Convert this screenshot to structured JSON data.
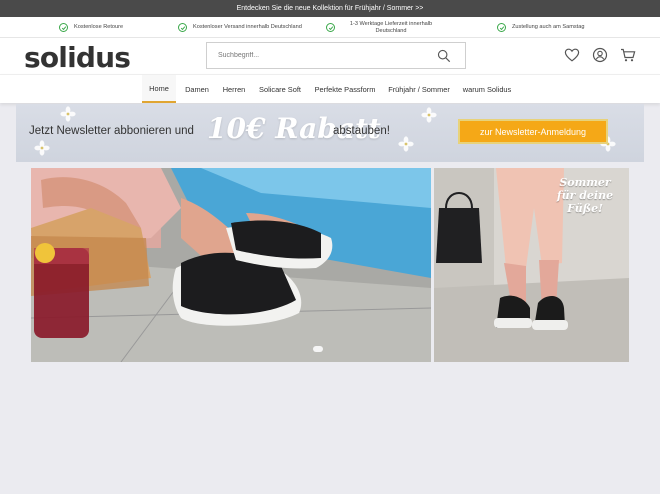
{
  "promo_bar": {
    "text": "Entdecken Sie die neue Kollektion für Frühjahr / Sommer >>"
  },
  "usp": [
    {
      "label": "Kostenlose Retoure"
    },
    {
      "label": "Kostenloser Versand innerhalb Deutschland"
    },
    {
      "label": "1-3 Werktage Lieferzeit innerhalb Deutschland"
    },
    {
      "label": "Zustellung auch am Samstag"
    }
  ],
  "header": {
    "logo": "solidus",
    "search_placeholder": "Suchbegriff..."
  },
  "nav": {
    "items": [
      {
        "label": "Home"
      },
      {
        "label": "Damen"
      },
      {
        "label": "Herren"
      },
      {
        "label": "Solicare Soft"
      },
      {
        "label": "Perfekte Passform"
      },
      {
        "label": "Frühjahr / Sommer"
      },
      {
        "label": "warum Solidus"
      }
    ],
    "active": "Home"
  },
  "newsletter": {
    "text_left": "Jetzt Newsletter abbonieren und",
    "highlight": "10€ Rabatt",
    "text_right": "abstauben!",
    "button": "zur Newsletter-Anmeldung"
  },
  "hero": {
    "right_text": "Sommer für deine Füße!"
  },
  "colors": {
    "accent": "#f5a817",
    "check": "#3aa84a",
    "promo_bg": "#4a4a4a"
  }
}
